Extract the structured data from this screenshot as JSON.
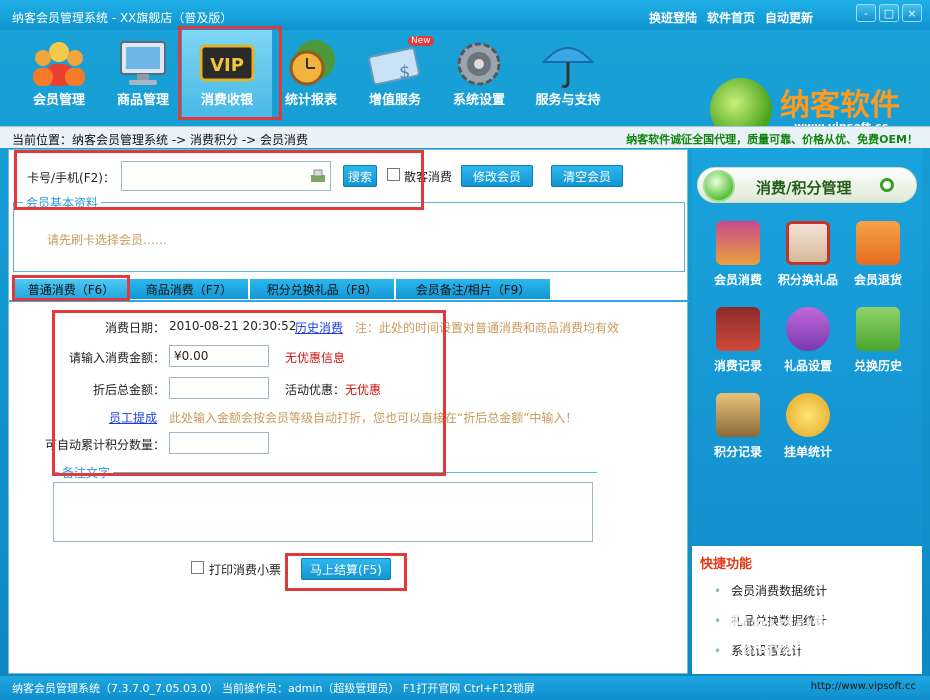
{
  "window": {
    "title": "纳客会员管理系统 - XX旗舰店（普及版）",
    "top_links": [
      "换班登陆",
      "软件首页",
      "自动更新"
    ],
    "controls": [
      "-",
      "□",
      "×"
    ]
  },
  "toolbar": {
    "items": [
      {
        "label": "会员管理",
        "icon": "members-icon"
      },
      {
        "label": "商品管理",
        "icon": "monitor-icon"
      },
      {
        "label": "消费收银",
        "icon": "vip-card-icon"
      },
      {
        "label": "统计报表",
        "icon": "clock-globe-icon"
      },
      {
        "label": "增值服务",
        "icon": "money-new-icon"
      },
      {
        "label": "系统设置",
        "icon": "gear-icon"
      },
      {
        "label": "服务与支持",
        "icon": "umbrella-icon"
      }
    ],
    "active_index": 2,
    "new_badge": "New"
  },
  "logo": {
    "name": "纳客软件",
    "url": "www.vipsoft.cc"
  },
  "breadcrumb": "当前位置：纳客会员管理系统 -> 消费积分 -> 会员消费",
  "promo": "纳客软件诚征全国代理，质量可靠、价格从优、免费OEM！",
  "search": {
    "card_label": "卡号/手机(F2)：",
    "card_value": "",
    "search_btn": "搜索",
    "walkin_label": "散客消费",
    "edit_btn": "修改会员",
    "clear_btn": "清空会员"
  },
  "member_info": {
    "legend": "会员基本资料",
    "hint": "请先刷卡选择会员……"
  },
  "tabs": [
    "普通消费（F6）",
    "商品消费（F7）",
    "积分兑换礼品（F8）",
    "会员备注/相片（F9）"
  ],
  "form": {
    "date_label": "消费日期：",
    "date_value": "2010-08-21 20:30:52",
    "history_link": "历史消费",
    "date_note": "注：此处的时间设置对普通消费和商品消费均有效",
    "amount_label": "请输入消费金额：",
    "amount_value": "¥0.00",
    "discount_info": "无优惠信息",
    "total_label": "折后总金额：",
    "total_value": "",
    "promo_label": "活动优惠：",
    "promo_value": "无优惠",
    "staff_link": "员工提成",
    "staff_note": "此处输入金额会按会员等级自动打折，您也可以直接在“折后总金额”中输入！",
    "points_label": "可自动累计积分数量：",
    "points_value": "",
    "remark_legend": "备注文字",
    "remark_value": "",
    "print_label": "打印消费小票",
    "checkout_btn": "马上结算(F5)"
  },
  "side": {
    "header": "消费/积分管理",
    "items": [
      {
        "label": "会员消费",
        "icon": "card-pay-icon"
      },
      {
        "label": "积分换礼品",
        "icon": "gift-icon"
      },
      {
        "label": "会员退货",
        "icon": "truck-icon"
      },
      {
        "label": "消费记录",
        "icon": "laptop-icon"
      },
      {
        "label": "礼品设置",
        "icon": "share-icon"
      },
      {
        "label": "兑换历史",
        "icon": "heart-icon"
      },
      {
        "label": "积分记录",
        "icon": "computer-icon"
      },
      {
        "label": "挂单统计",
        "icon": "coin-icon"
      }
    ],
    "quick_title": "快捷功能",
    "quick_items": [
      "会员消费数据统计",
      "礼品兑换数据统计",
      "系统设置统计"
    ]
  },
  "status": {
    "left": "纳客会员管理系统（7.3.7.0_7.05.03.0）    当前操作员：admin（超级管理员）   F1打开官网 Ctrl+F12锁屏",
    "right": "http://www.vipsoft.cc"
  },
  "watermark": {
    "text": "Baidu经验",
    "sub": "jingyan.baidu.com"
  },
  "colors": {
    "accent": "#1395d4",
    "highlight_box": "#e23a3a",
    "logo_orange": "#ff9a1e"
  }
}
